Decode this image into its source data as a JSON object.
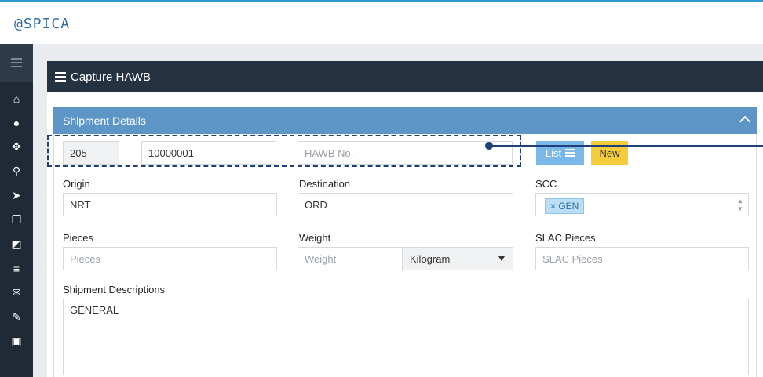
{
  "app": {
    "logo_text": "SPICA",
    "logo_prefix": "@"
  },
  "sidebar": {
    "items": [
      {
        "icon": "home-icon",
        "glyph": "⌂"
      },
      {
        "icon": "user-icon",
        "glyph": "●"
      },
      {
        "icon": "crosshair-icon",
        "glyph": "✥"
      },
      {
        "icon": "search-icon",
        "glyph": "⚲"
      },
      {
        "icon": "send-icon",
        "glyph": "➤"
      },
      {
        "icon": "copy-icon",
        "glyph": "❐"
      },
      {
        "icon": "external-link-icon",
        "glyph": "◩"
      },
      {
        "icon": "list-icon",
        "glyph": "≡"
      },
      {
        "icon": "envelope-icon",
        "glyph": "✉"
      },
      {
        "icon": "edit-icon",
        "glyph": "✎"
      },
      {
        "icon": "pdf-icon",
        "glyph": "▣"
      }
    ]
  },
  "panel": {
    "title": "Capture HAWB"
  },
  "shipment": {
    "section_title": "Shipment Details",
    "mawb_prefix": "205",
    "mawb_number": "10000001",
    "hawb_placeholder": "HAWB No.",
    "list_button": "List",
    "new_button": "New",
    "origin_label": "Origin",
    "origin_value": "NRT",
    "destination_label": "Destination",
    "destination_value": "ORD",
    "scc_label": "SCC",
    "scc_tag": "× GEN",
    "pieces_label": "Pieces",
    "pieces_placeholder": "Pieces",
    "weight_label": "Weight",
    "weight_placeholder": "Weight",
    "weight_unit": "Kilogram",
    "slac_label": "SLAC Pieces",
    "slac_placeholder": "SLAC Pieces",
    "desc_label": "Shipment Descriptions",
    "desc_value": "GENERAL"
  },
  "colors": {
    "sidebar_bg": "#1f2a36",
    "panel_header_bg": "#243241",
    "section_header_bg": "#5d96c6",
    "list_button_bg": "#79b8e9",
    "new_button_bg": "#f4cb3b",
    "highlight_color": "#1e3f7a"
  }
}
